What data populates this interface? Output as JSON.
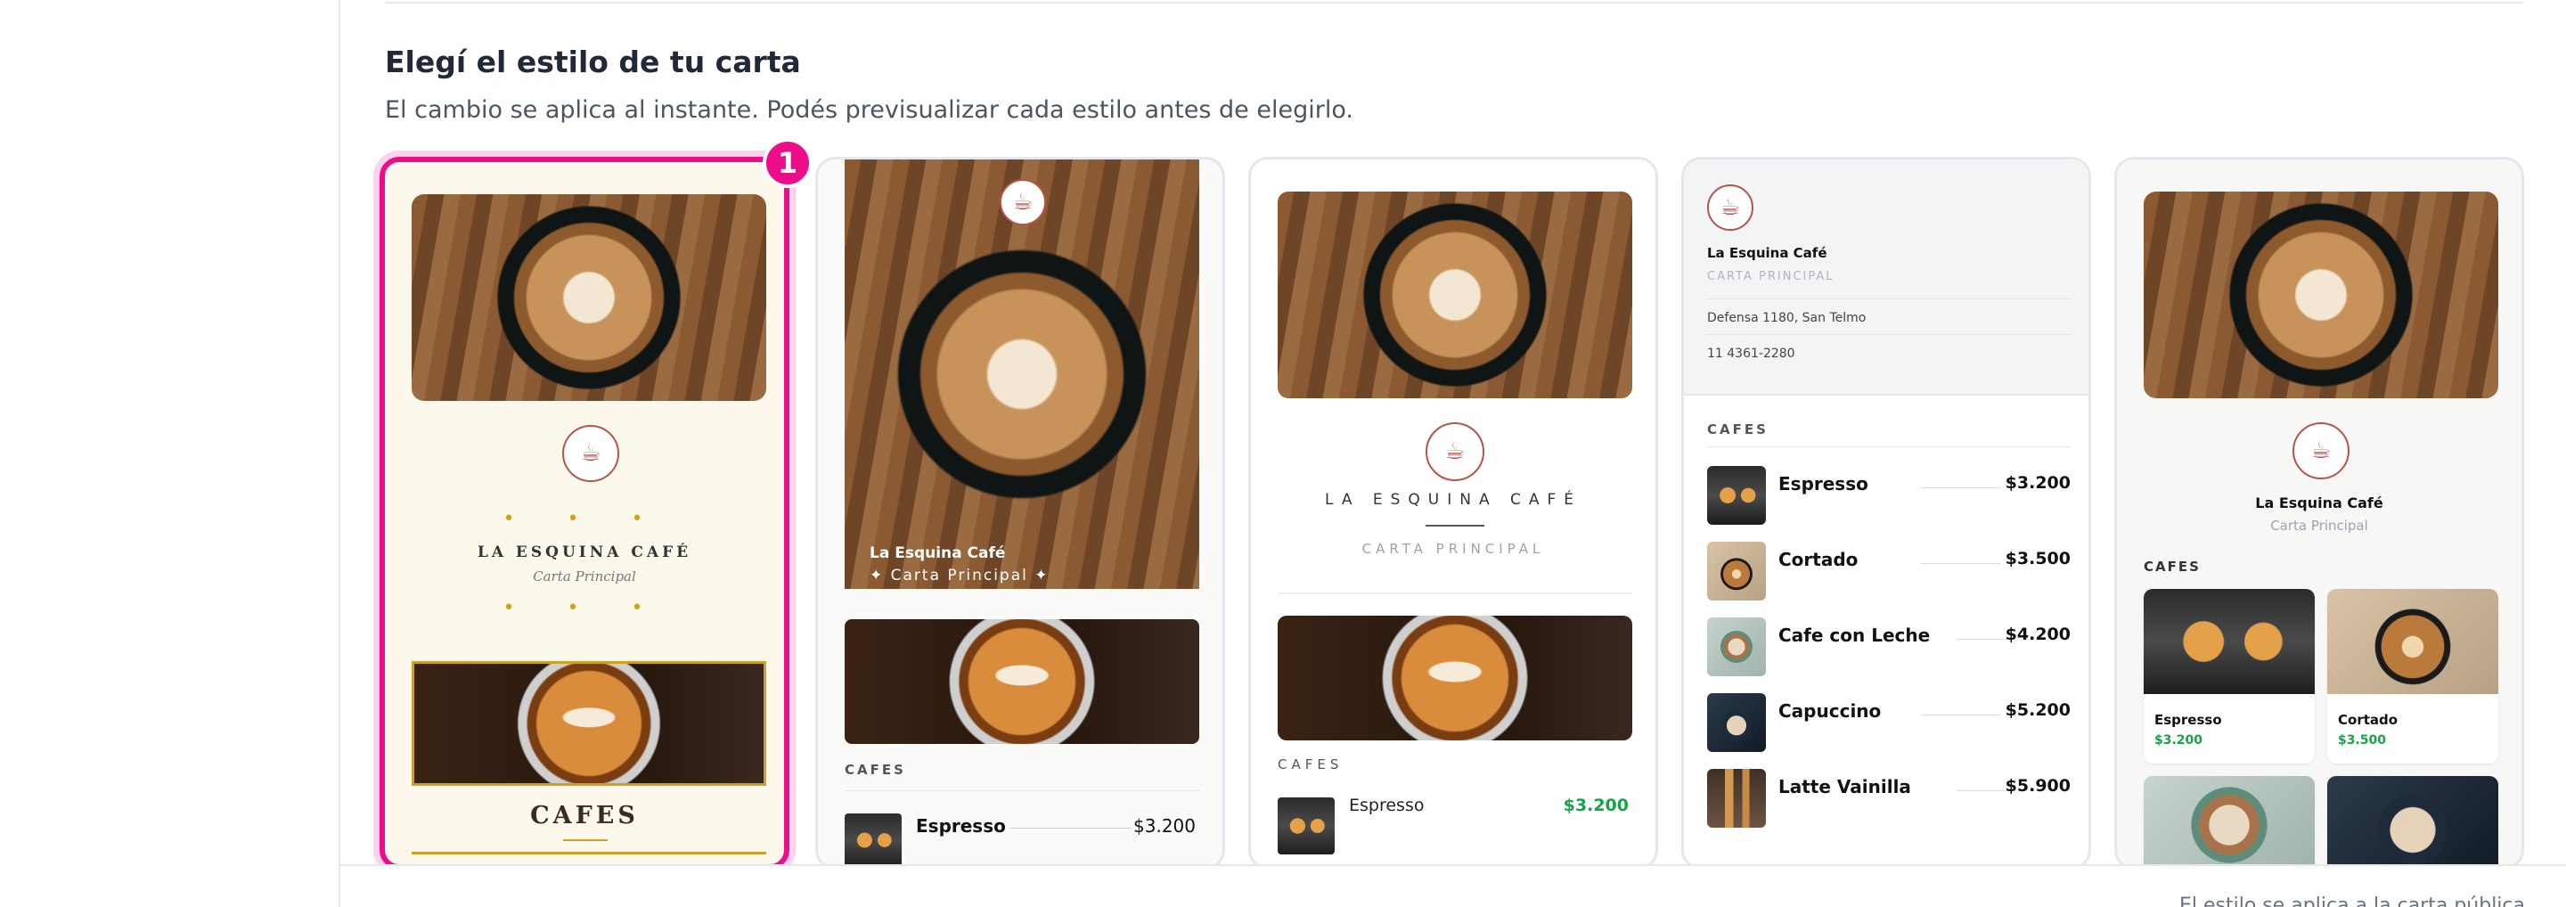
{
  "section": {
    "title": "Elegí el estilo de tu carta",
    "subtitle": "El cambio se aplica al instante. Podés previsualizar cada estilo antes de elegirlo."
  },
  "selected_badge": "1",
  "brand": {
    "pink": "#ec0d8a",
    "green_price": "#16a34a",
    "gold": "#c9a227"
  },
  "cards": {
    "c1": {
      "name": "LA ESQUINA CAFÉ",
      "tag": "Carta Principal",
      "section": "CAFES",
      "dots": "• • •"
    },
    "c2": {
      "name": "La Esquina Café",
      "tag": "✦ Carta Principal ✦",
      "section": "CAFES",
      "item_name": "Espresso",
      "item_price": "$3.200"
    },
    "c3": {
      "name": "LA ESQUINA CAFÉ",
      "tag": "CARTA PRINCIPAL",
      "section": "CAFES",
      "item_name": "Espresso",
      "item_price": "$3.200"
    },
    "c4": {
      "name": "La Esquina Café",
      "tag": "CARTA PRINCIPAL",
      "address": "Defensa 1180, San Telmo",
      "phone": "11 4361-2280",
      "section": "CAFES",
      "items": [
        {
          "name": "Espresso",
          "price": "$3.200"
        },
        {
          "name": "Cortado",
          "price": "$3.500"
        },
        {
          "name": "Cafe con Leche",
          "price": "$4.200"
        },
        {
          "name": "Capuccino",
          "price": "$5.200"
        },
        {
          "name": "Latte Vainilla",
          "price": "$5.900"
        }
      ]
    },
    "c5": {
      "name": "La Esquina Café",
      "tag": "Carta Principal",
      "section": "CAFES",
      "items": [
        {
          "name": "Espresso",
          "price": "$3.200"
        },
        {
          "name": "Cortado",
          "price": "$3.500"
        }
      ]
    }
  },
  "footer": {
    "text": "El estilo se aplica a la carta pública"
  }
}
